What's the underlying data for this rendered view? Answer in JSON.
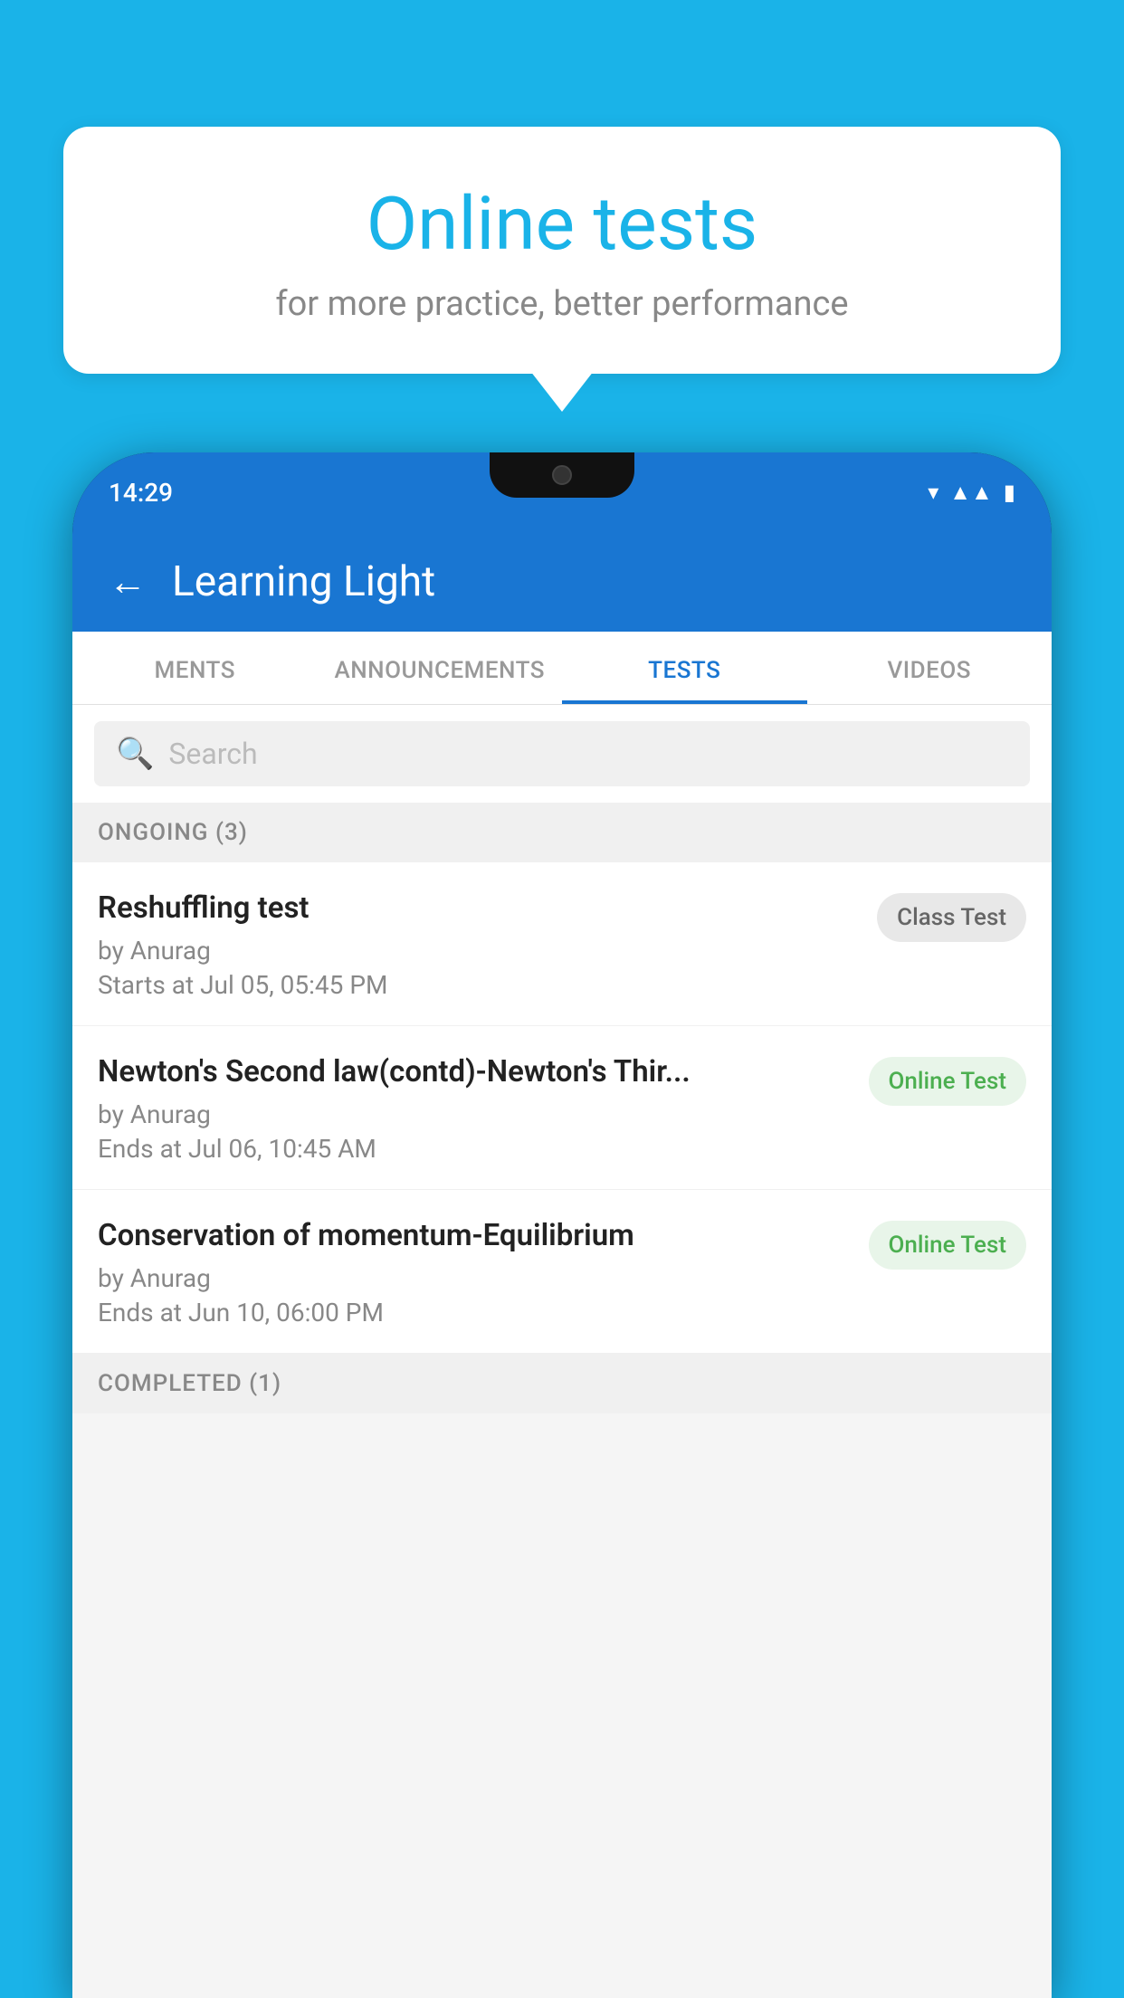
{
  "background_color": "#1ab3e8",
  "bubble": {
    "title": "Online tests",
    "subtitle": "for more practice, better performance"
  },
  "phone": {
    "status_time": "14:29",
    "app_title": "Learning Light",
    "back_label": "←",
    "tabs": [
      {
        "label": "MENTS",
        "active": false
      },
      {
        "label": "ANNOUNCEMENTS",
        "active": false
      },
      {
        "label": "TESTS",
        "active": true
      },
      {
        "label": "VIDEOS",
        "active": false
      }
    ],
    "search_placeholder": "Search",
    "ongoing_label": "ONGOING (3)",
    "completed_label": "COMPLETED (1)",
    "tests": [
      {
        "title": "Reshuffling test",
        "author": "by Anurag",
        "date": "Starts at  Jul 05, 05:45 PM",
        "badge": "Class Test",
        "badge_type": "class"
      },
      {
        "title": "Newton's Second law(contd)-Newton's Thir...",
        "author": "by Anurag",
        "date": "Ends at  Jul 06, 10:45 AM",
        "badge": "Online Test",
        "badge_type": "online"
      },
      {
        "title": "Conservation of momentum-Equilibrium",
        "author": "by Anurag",
        "date": "Ends at  Jun 10, 06:00 PM",
        "badge": "Online Test",
        "badge_type": "online"
      }
    ]
  }
}
